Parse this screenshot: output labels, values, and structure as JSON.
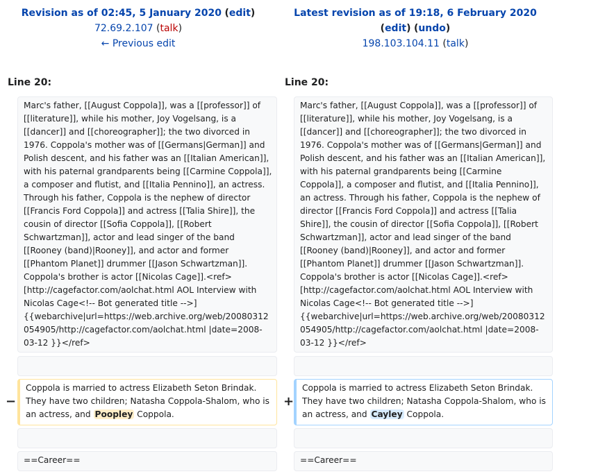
{
  "left_header": {
    "title": "Revision as of 02:45, 5 January 2020",
    "edit": "edit",
    "user": "72.69.2.107",
    "talk": "talk",
    "prev_edit": "← Previous edit"
  },
  "right_header": {
    "title": "Latest revision as of 19:18, 6 February 2020",
    "edit": "edit",
    "undo": "undo",
    "user": "198.103.104.11",
    "talk": "talk"
  },
  "line_labels": {
    "left": "Line 20:",
    "right": "Line 20:"
  },
  "context_paragraph": {
    "left": "Marc's father, [[August Coppola]], was a [[professor]] of [[literature]], while his mother, Joy Vogelsang, is a [[dancer]] and [[choreographer]]; the two divorced in 1976. Coppola's mother was of [[Germans|German]] and Polish descent, and his father was an [[Italian American]], with his paternal grandparents being [[Carmine Coppola]], a composer and flutist, and [[Italia Pennino]], an actress. Through his father, Coppola is the nephew of director [[Francis Ford Coppola]] and actress [[Talia Shire]], the cousin of director [[Sofia Coppola]], [[Robert Schwartzman]], actor and lead singer of the band [[Rooney (band)|Rooney]], and actor and former [[Phantom Planet]] drummer [[Jason Schwartzman]]. Coppola's brother is actor [[Nicolas Cage]].<ref>[http://cagefactor.com/aolchat.html AOL Interview with Nicolas Cage<!-- Bot generated title -->] {{webarchive|url=https://web.archive.org/web/20080312054905/http://cagefactor.com/aolchat.html |date=2008-03-12 }}</ref>",
    "right": "Marc's father, [[August Coppola]], was a [[professor]] of [[literature]], while his mother, Joy Vogelsang, is a [[dancer]] and [[choreographer]]; the two divorced in 1976. Coppola's mother was of [[Germans|German]] and Polish descent, and his father was an [[Italian American]], with his paternal grandparents being [[Carmine Coppola]], a composer and flutist, and [[Italia Pennino]], an actress. Through his father, Coppola is the nephew of director [[Francis Ford Coppola]] and actress [[Talia Shire]], the cousin of director [[Sofia Coppola]], [[Robert Schwartzman]], actor and lead singer of the band [[Rooney (band)|Rooney]], and actor and former [[Phantom Planet]] drummer [[Jason Schwartzman]]. Coppola's brother is actor [[Nicolas Cage]].<ref>[http://cagefactor.com/aolchat.html AOL Interview with Nicolas Cage<!-- Bot generated title -->] {{webarchive|url=https://web.archive.org/web/20080312054905/http://cagefactor.com/aolchat.html |date=2008-03-12 }}</ref>"
  },
  "changed_line": {
    "deleted_marker": "−",
    "added_marker": "+",
    "prefix": "Coppola is married to actress Elizabeth Seton Brindak. They have two children; Natasha Coppola-Shalom, who is an actress, and ",
    "deleted_word": "Poopley",
    "added_word": "Cayley",
    "suffix": " Coppola."
  },
  "career_line": {
    "left": "==Career==",
    "right": "==Career=="
  },
  "colors": {
    "link": "#0645ad",
    "talk_link": "#ba0000",
    "deleted_border": "#ffe49c",
    "added_border": "#a3d3ff",
    "deleted_highlight": "#feeec8",
    "added_highlight": "#d8ecff"
  }
}
